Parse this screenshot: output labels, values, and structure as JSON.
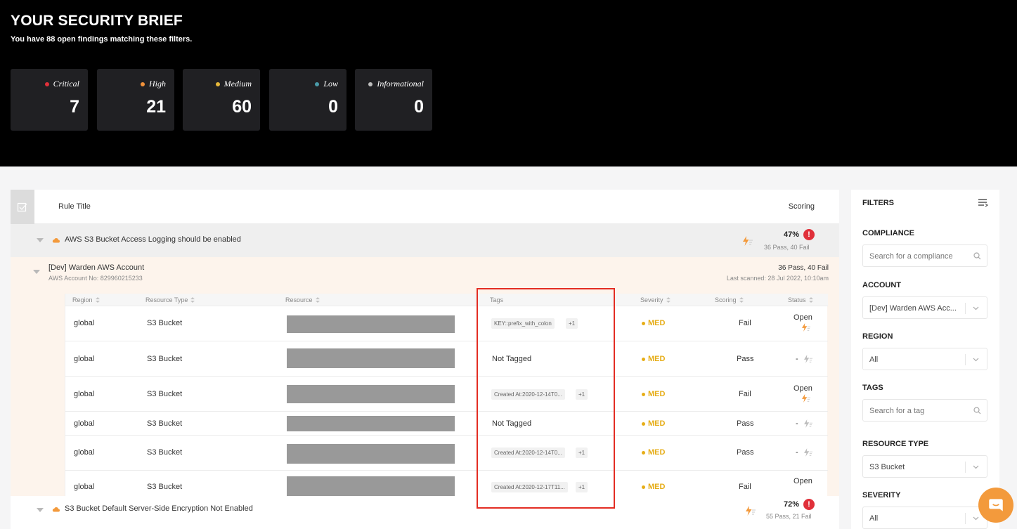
{
  "header": {
    "title": "YOUR SECURITY BRIEF",
    "subtitle": "You have 88 open findings matching these filters."
  },
  "severity_cards": [
    {
      "label": "Critical",
      "count": "7",
      "color": "#e0303a"
    },
    {
      "label": "High",
      "count": "21",
      "color": "#f0913a"
    },
    {
      "label": "Medium",
      "count": "60",
      "color": "#e6b83a"
    },
    {
      "label": "Low",
      "count": "0",
      "color": "#4a9aa8"
    },
    {
      "label": "Informational",
      "count": "0",
      "color": "#bdbdbd"
    }
  ],
  "table": {
    "col_rule_title": "Rule Title",
    "col_scoring": "Scoring"
  },
  "rules": [
    {
      "title": "AWS S3 Bucket Access Logging should be enabled",
      "pct": "47%",
      "sub": "36 Pass, 40 Fail"
    },
    {
      "title": "S3 Bucket Default Server-Side Encryption Not Enabled",
      "pct": "72%",
      "sub": "55 Pass, 21 Fail"
    }
  ],
  "account": {
    "name": "[Dev] Warden AWS Account",
    "number": "AWS Account No: 829960215233",
    "result": "36 Pass, 40 Fail",
    "scanned": "Last scanned: 28 Jul 2022, 10:10am"
  },
  "resource_columns": {
    "region": "Region",
    "resource_type": "Resource Type",
    "resource": "Resource",
    "tags": "Tags",
    "severity": "Severity",
    "scoring": "Scoring",
    "status": "Status"
  },
  "resource_rows": [
    {
      "region": "global",
      "type": "S3 Bucket",
      "tag": "KEY::prefix_with_colon",
      "tag_more": "+1",
      "severity": "MED",
      "scoring": "Fail",
      "status": "Open"
    },
    {
      "region": "global",
      "type": "S3 Bucket",
      "tag": "Not Tagged",
      "tag_more": "",
      "severity": "MED",
      "scoring": "Pass",
      "status": "-"
    },
    {
      "region": "global",
      "type": "S3 Bucket",
      "tag": "Created At:2020-12-14T0...",
      "tag_more": "+1",
      "severity": "MED",
      "scoring": "Fail",
      "status": "Open"
    },
    {
      "region": "global",
      "type": "S3 Bucket",
      "tag": "Not Tagged",
      "tag_more": "",
      "severity": "MED",
      "scoring": "Pass",
      "status": "-"
    },
    {
      "region": "global",
      "type": "S3 Bucket",
      "tag": "Created At:2020-12-14T0...",
      "tag_more": "+1",
      "severity": "MED",
      "scoring": "Pass",
      "status": "-"
    },
    {
      "region": "global",
      "type": "S3 Bucket",
      "tag": "Created At:2020-12-17T11...",
      "tag_more": "+1",
      "severity": "MED",
      "scoring": "Fail",
      "status": "Open"
    }
  ],
  "filters": {
    "title": "FILTERS",
    "compliance_label": "COMPLIANCE",
    "compliance_placeholder": "Search for a compliance",
    "account_label": "ACCOUNT",
    "account_value": "[Dev] Warden AWS Acc...",
    "region_label": "REGION",
    "region_value": "All",
    "tags_label": "TAGS",
    "tags_placeholder": "Search for a tag",
    "resource_type_label": "RESOURCE TYPE",
    "resource_type_value": "S3 Bucket",
    "severity_label": "SEVERITY",
    "severity_value": "All"
  },
  "icons": {
    "cloud": "aws-cloud-icon",
    "bolt": "remediation-bolt-icon",
    "alert": "alert-icon",
    "chat": "chat-icon"
  },
  "colors": {
    "accent_orange": "#f39a3c",
    "alert_red": "#e0303a",
    "medium_yellow": "#e6ad17",
    "highlight_red": "#e32d23"
  }
}
